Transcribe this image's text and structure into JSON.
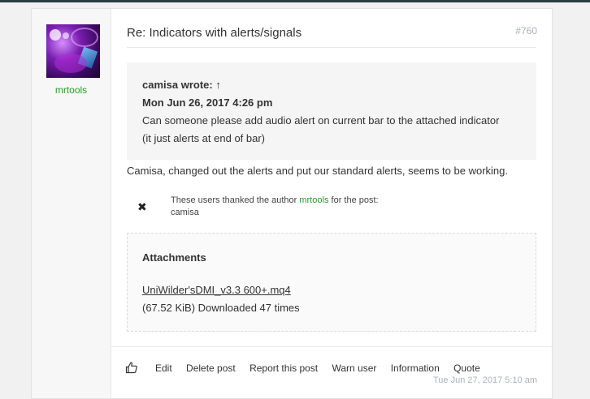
{
  "author": {
    "username": "mrtools"
  },
  "post": {
    "title": "Re: Indicators with alerts/signals",
    "number": "#760",
    "quote": {
      "author": "camisa wrote:",
      "arrow": "↑",
      "date": "Mon Jun 26, 2017 4:26 pm",
      "line1": "Can someone please add audio alert on current bar to the attached indicator",
      "line2": "(it just alerts at end of bar)"
    },
    "body": "Camisa, changed out the alerts and put our standard alerts, seems to be working.",
    "thanks": {
      "prefix": "These users thanked the author",
      "author": "mrtools",
      "suffix": "for the post:",
      "users": "camisa"
    },
    "attachments": {
      "title": "Attachments",
      "file_name": "UniWilder'sDMI_v3.3 600+.mq4",
      "meta": "(67.52 KiB) Downloaded 47 times"
    },
    "actions": {
      "edit": "Edit",
      "delete": "Delete post",
      "report": "Report this post",
      "warn": "Warn user",
      "info": "Information",
      "quote": "Quote"
    },
    "date": "Tue Jun 27, 2017 5:10 am"
  },
  "icons": {
    "like": "thumbs-up-icon",
    "thanks_remove": "x-icon"
  }
}
